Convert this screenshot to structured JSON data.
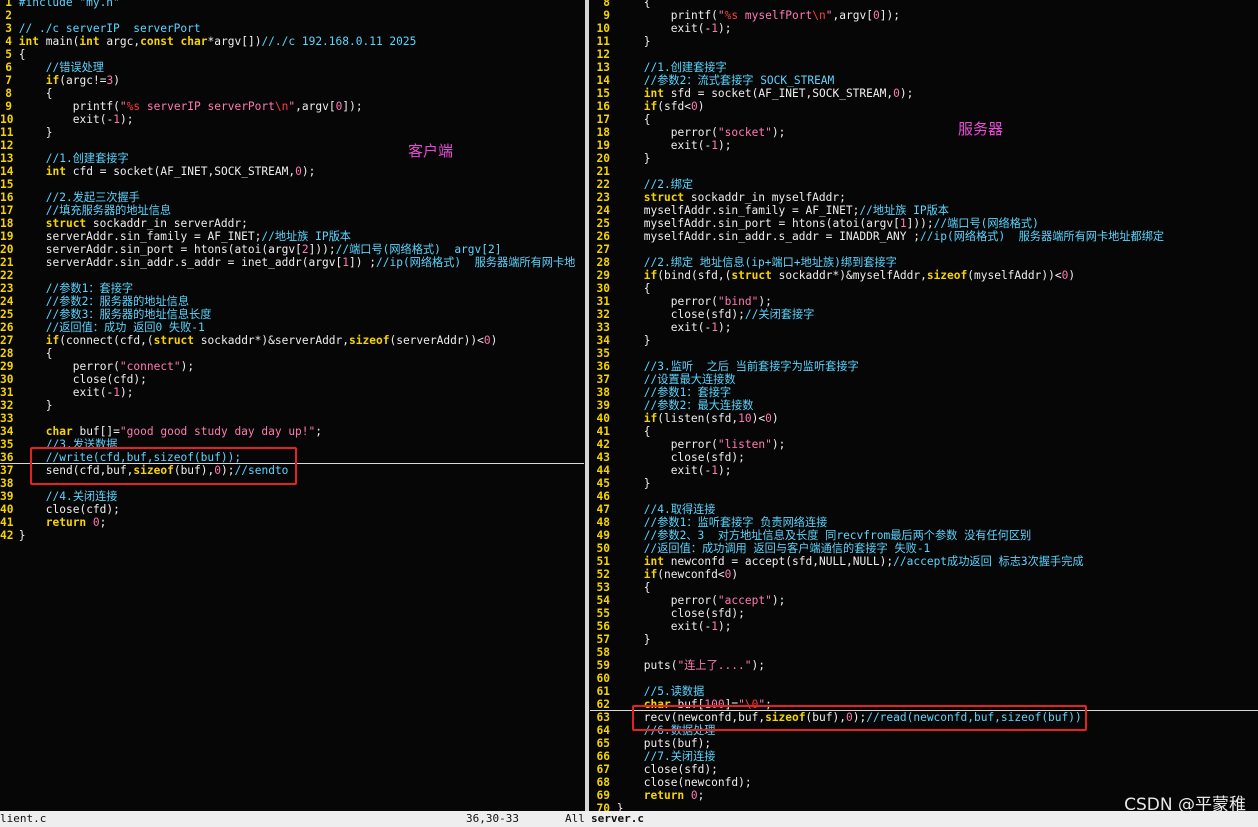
{
  "left_pane": {
    "label": "客户端",
    "lines": [
      {
        "n": "1",
        "t": "#include \"my.h\""
      },
      {
        "n": "2",
        "t": ""
      },
      {
        "n": "3",
        "t": "// ./c serverIP  serverPort"
      },
      {
        "n": "4",
        "t": "int main(int argc,const char*argv[])//./c 192.168.0.11 2025"
      },
      {
        "n": "5",
        "t": "{"
      },
      {
        "n": "6",
        "t": "    //错误处理"
      },
      {
        "n": "7",
        "t": "    if(argc!=3)"
      },
      {
        "n": "8",
        "t": "    {"
      },
      {
        "n": "9",
        "t": "        printf(\"%s serverIP serverPort\\n\",argv[0]);"
      },
      {
        "n": "10",
        "t": "        exit(-1);"
      },
      {
        "n": "11",
        "t": "    }"
      },
      {
        "n": "12",
        "t": ""
      },
      {
        "n": "13",
        "t": "    //1.创建套接字"
      },
      {
        "n": "14",
        "t": "    int cfd = socket(AF_INET,SOCK_STREAM,0);"
      },
      {
        "n": "15",
        "t": ""
      },
      {
        "n": "16",
        "t": "    //2.发起三次握手"
      },
      {
        "n": "17",
        "t": "    //填充服务器的地址信息"
      },
      {
        "n": "18",
        "t": "    struct sockaddr_in serverAddr;"
      },
      {
        "n": "19",
        "t": "    serverAddr.sin_family = AF_INET;//地址族 IP版本"
      },
      {
        "n": "20",
        "t": "    serverAddr.sin_port = htons(atoi(argv[2]));//端口号(网络格式)  argv[2]"
      },
      {
        "n": "21",
        "t": "    serverAddr.sin_addr.s_addr = inet_addr(argv[1]) ;//ip(网络格式)  服务器端所有网卡地"
      },
      {
        "n": "22",
        "t": ""
      },
      {
        "n": "23",
        "t": "    //参数1：套接字"
      },
      {
        "n": "24",
        "t": "    //参数2：服务器的地址信息"
      },
      {
        "n": "25",
        "t": "    //参数3：服务器的地址信息长度"
      },
      {
        "n": "26",
        "t": "    //返回值：成功 返回0 失败-1"
      },
      {
        "n": "27",
        "t": "    if(connect(cfd,(struct sockaddr*)&serverAddr,sizeof(serverAddr))<0)"
      },
      {
        "n": "28",
        "t": "    {"
      },
      {
        "n": "29",
        "t": "        perror(\"connect\");"
      },
      {
        "n": "30",
        "t": "        close(cfd);"
      },
      {
        "n": "31",
        "t": "        exit(-1);"
      },
      {
        "n": "32",
        "t": "    }"
      },
      {
        "n": "33",
        "t": ""
      },
      {
        "n": "34",
        "t": "    char buf[]=\"good good study day day up!\";"
      },
      {
        "n": "35",
        "t": "    //3.发送数据"
      },
      {
        "n": "36",
        "t": "    //write(cfd,buf,sizeof(buf));"
      },
      {
        "n": "37",
        "t": "    send(cfd,buf,sizeof(buf),0);//sendto"
      },
      {
        "n": "38",
        "t": ""
      },
      {
        "n": "39",
        "t": "    //4.关闭连接"
      },
      {
        "n": "40",
        "t": "    close(cfd);"
      },
      {
        "n": "41",
        "t": "    return 0;"
      },
      {
        "n": "42",
        "t": "}"
      }
    ]
  },
  "right_pane": {
    "label": "服务器",
    "lines": [
      {
        "n": "8",
        "t": "    {"
      },
      {
        "n": "9",
        "t": "        printf(\"%s myselfPort\\n\",argv[0]);"
      },
      {
        "n": "10",
        "t": "        exit(-1);"
      },
      {
        "n": "11",
        "t": "    }"
      },
      {
        "n": "12",
        "t": ""
      },
      {
        "n": "13",
        "t": "    //1.创建套接字"
      },
      {
        "n": "14",
        "t": "    //参数2：流式套接字 SOCK_STREAM"
      },
      {
        "n": "15",
        "t": "    int sfd = socket(AF_INET,SOCK_STREAM,0);"
      },
      {
        "n": "16",
        "t": "    if(sfd<0)"
      },
      {
        "n": "17",
        "t": "    {"
      },
      {
        "n": "18",
        "t": "        perror(\"socket\");"
      },
      {
        "n": "19",
        "t": "        exit(-1);"
      },
      {
        "n": "20",
        "t": "    }"
      },
      {
        "n": "21",
        "t": ""
      },
      {
        "n": "22",
        "t": "    //2.绑定"
      },
      {
        "n": "23",
        "t": "    struct sockaddr_in myselfAddr;"
      },
      {
        "n": "24",
        "t": "    myselfAddr.sin_family = AF_INET;//地址族 IP版本"
      },
      {
        "n": "25",
        "t": "    myselfAddr.sin_port = htons(atoi(argv[1]));//端口号(网络格式)"
      },
      {
        "n": "26",
        "t": "    myselfAddr.sin_addr.s_addr = INADDR_ANY ;//ip(网络格式)  服务器端所有网卡地址都绑定"
      },
      {
        "n": "27",
        "t": ""
      },
      {
        "n": "28",
        "t": "    //2.绑定 地址信息(ip+端口+地址族)绑到套接字"
      },
      {
        "n": "29",
        "t": "    if(bind(sfd,(struct sockaddr*)&myselfAddr,sizeof(myselfAddr))<0)"
      },
      {
        "n": "30",
        "t": "    {"
      },
      {
        "n": "31",
        "t": "        perror(\"bind\");"
      },
      {
        "n": "32",
        "t": "        close(sfd);//关闭套接字"
      },
      {
        "n": "33",
        "t": "        exit(-1);"
      },
      {
        "n": "34",
        "t": "    }"
      },
      {
        "n": "35",
        "t": ""
      },
      {
        "n": "36",
        "t": "    //3.监听  之后 当前套接字为监听套接字"
      },
      {
        "n": "37",
        "t": "    //设置最大连接数"
      },
      {
        "n": "38",
        "t": "    //参数1：套接字"
      },
      {
        "n": "39",
        "t": "    //参数2：最大连接数"
      },
      {
        "n": "40",
        "t": "    if(listen(sfd,10)<0)"
      },
      {
        "n": "41",
        "t": "    {"
      },
      {
        "n": "42",
        "t": "        perror(\"listen\");"
      },
      {
        "n": "43",
        "t": "        close(sfd);"
      },
      {
        "n": "44",
        "t": "        exit(-1);"
      },
      {
        "n": "45",
        "t": "    }"
      },
      {
        "n": "46",
        "t": ""
      },
      {
        "n": "47",
        "t": "    //4.取得连接"
      },
      {
        "n": "48",
        "t": "    //参数1：监听套接字 负责网络连接"
      },
      {
        "n": "49",
        "t": "    //参数2、3  对方地址信息及长度 同recvfrom最后两个参数 没有任何区别"
      },
      {
        "n": "50",
        "t": "    //返回值：成功调用 返回与客户端通信的套接字 失败-1"
      },
      {
        "n": "51",
        "t": "    int newconfd = accept(sfd,NULL,NULL);//accept成功返回 标志3次握手完成"
      },
      {
        "n": "52",
        "t": "    if(newconfd<0)"
      },
      {
        "n": "53",
        "t": "    {"
      },
      {
        "n": "54",
        "t": "        perror(\"accept\");"
      },
      {
        "n": "55",
        "t": "        close(sfd);"
      },
      {
        "n": "56",
        "t": "        exit(-1);"
      },
      {
        "n": "57",
        "t": "    }"
      },
      {
        "n": "58",
        "t": ""
      },
      {
        "n": "59",
        "t": "    puts(\"连上了....\");"
      },
      {
        "n": "60",
        "t": ""
      },
      {
        "n": "61",
        "t": "    //5.读数据"
      },
      {
        "n": "62",
        "t": "    char buf[100]=\"\\0\";"
      },
      {
        "n": "63",
        "t": "    recv(newconfd,buf,sizeof(buf),0);//read(newconfd,buf,sizeof(buf))"
      },
      {
        "n": "64",
        "t": "    //6.数据处理"
      },
      {
        "n": "65",
        "t": "    puts(buf);"
      },
      {
        "n": "66",
        "t": "    //7.关闭连接"
      },
      {
        "n": "67",
        "t": "    close(sfd);"
      },
      {
        "n": "68",
        "t": "    close(newconfd);"
      },
      {
        "n": "69",
        "t": "    return 0;"
      },
      {
        "n": "70",
        "t": "}"
      }
    ]
  },
  "status_bar": {
    "left_file": "lient.c",
    "left_position": "36,30-33",
    "left_scroll": "All",
    "right_file": "server.c"
  },
  "watermark": "CSDN @平蒙稚"
}
